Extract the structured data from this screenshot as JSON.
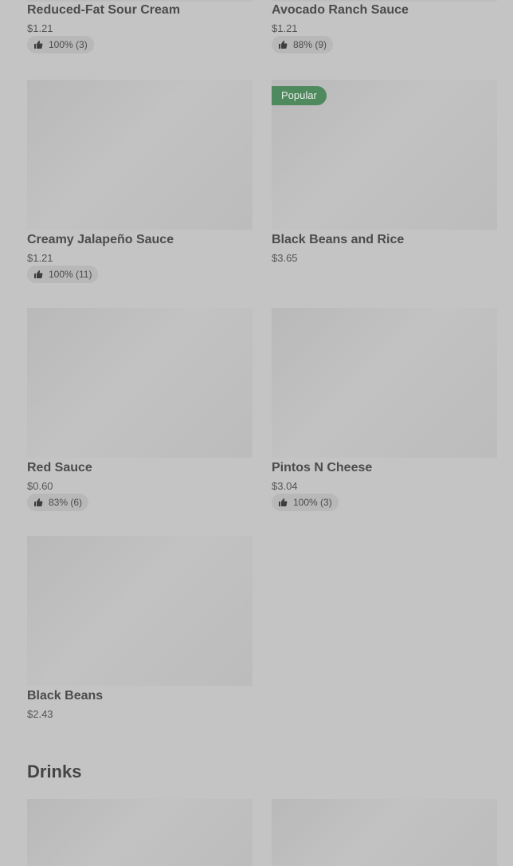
{
  "items": [
    {
      "name": "Reduced-Fat Sour Cream",
      "price": "$1.21",
      "rating": "100% (3)"
    },
    {
      "name": "Avocado Ranch Sauce",
      "price": "$1.21",
      "rating": "88% (9)"
    },
    {
      "name": "Creamy Jalapeño Sauce",
      "price": "$1.21",
      "rating": "100% (11)"
    },
    {
      "name": "Black Beans and Rice",
      "price": "$3.65",
      "badge": "Popular"
    },
    {
      "name": "Red Sauce",
      "price": "$0.60",
      "rating": "83% (6)"
    },
    {
      "name": "Pintos N Cheese",
      "price": "$3.04",
      "rating": "100% (3)"
    },
    {
      "name": "Black Beans",
      "price": "$2.43"
    }
  ],
  "sections": {
    "drinks_title": "Drinks"
  },
  "icons": {
    "rating": "thumbs-up-icon"
  },
  "colors": {
    "popular_badge": "#4f8a5f",
    "background": "#c4c4c4"
  }
}
